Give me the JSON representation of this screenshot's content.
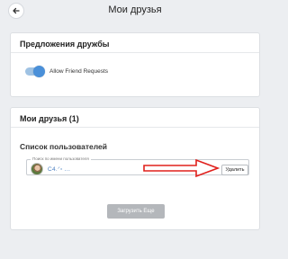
{
  "header": {
    "title": "Мои друзья"
  },
  "friend_suggestions": {
    "title": "Предложения дружбы",
    "toggle_label": "Allow Friend Requests",
    "toggle_on": true
  },
  "my_friends": {
    "title": "Мои друзья (1)",
    "list_title": "Список пользователей",
    "search": {
      "label": "Поиск по имени пользователя",
      "value": ""
    },
    "friends": [
      {
        "name": "C4.ᐟ▫ ...",
        "delete_label": "Удалить"
      }
    ],
    "load_more_label": "Загрузить Еще"
  },
  "colors": {
    "accent": "#4a90d9",
    "annotation_arrow": "#e0201c",
    "link": "#4a7fc0",
    "disabled_button": "#b4b7bb"
  },
  "icons": [
    "arrow-left-icon",
    "search-icon"
  ]
}
